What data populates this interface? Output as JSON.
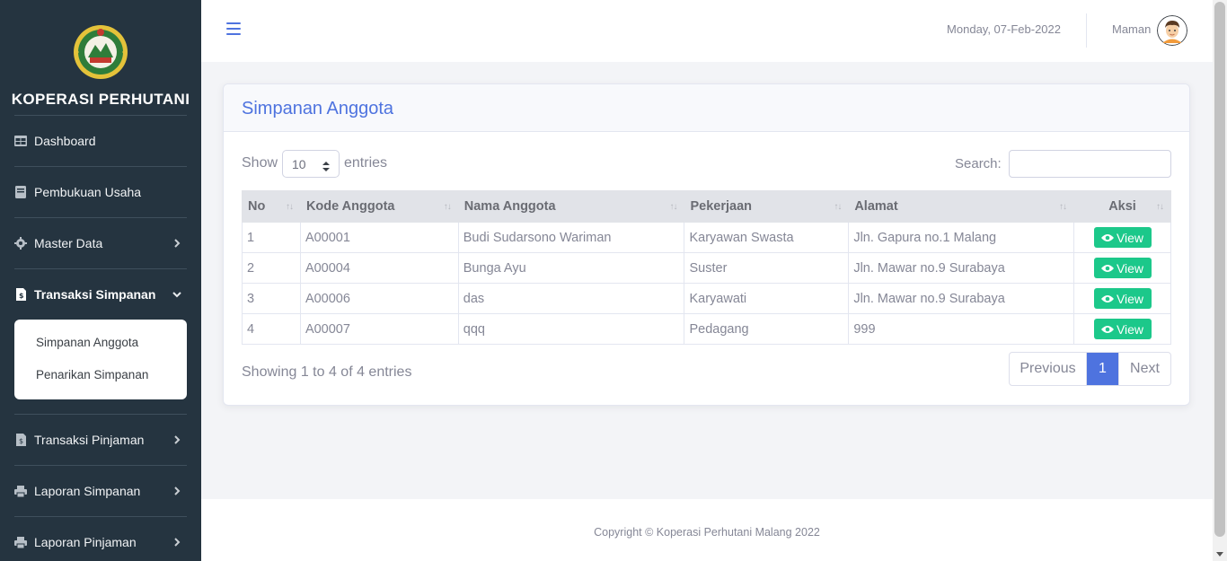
{
  "sidebar": {
    "brand": "KOPERASI PERHUTANI",
    "menu": {
      "dashboard": "Dashboard",
      "pembukuan": "Pembukuan Usaha",
      "master": "Master Data",
      "transaksi_simpanan": "Transaksi Simpanan",
      "transaksi_pinjaman": "Transaksi Pinjaman",
      "laporan_simpanan": "Laporan Simpanan",
      "laporan_pinjaman": "Laporan Pinjaman"
    },
    "submenu": {
      "simpanan_anggota": "Simpanan Anggota",
      "penarikan_simpanan": "Penarikan Simpanan"
    }
  },
  "topbar": {
    "date": "Monday, 07-Feb-2022",
    "user": "Maman"
  },
  "card": {
    "title": "Simpanan Anggota",
    "show_label": "Show",
    "entries_value": "10",
    "entries_label": "entries",
    "search_label": "Search:",
    "search_value": ""
  },
  "table": {
    "headers": {
      "no": "No",
      "kode": "Kode Anggota",
      "nama": "Nama Anggota",
      "pekerjaan": "Pekerjaan",
      "alamat": "Alamat",
      "aksi": "Aksi"
    },
    "rows": [
      {
        "no": "1",
        "kode": "A00001",
        "nama": "Budi Sudarsono Wariman",
        "pekerjaan": "Karyawan Swasta",
        "alamat": "Jln. Gapura no.1 Malang",
        "aksi": "View"
      },
      {
        "no": "2",
        "kode": "A00004",
        "nama": "Bunga Ayu",
        "pekerjaan": "Suster",
        "alamat": "Jln. Mawar no.9 Surabaya",
        "aksi": "View"
      },
      {
        "no": "3",
        "kode": "A00006",
        "nama": "das",
        "pekerjaan": "Karyawati",
        "alamat": "Jln. Mawar no.9 Surabaya",
        "aksi": "View"
      },
      {
        "no": "4",
        "kode": "A00007",
        "nama": "qqq",
        "pekerjaan": "Pedagang",
        "alamat": "999",
        "aksi": "View"
      }
    ]
  },
  "pagination": {
    "info": "Showing 1 to 4 of 4 entries",
    "previous": "Previous",
    "current": "1",
    "next": "Next"
  },
  "footer": {
    "copyright": "Copyright © Koperasi Perhutani Malang 2022"
  },
  "colors": {
    "sidebar_bg": "#253440",
    "primary": "#4e73df",
    "success": "#1cc88a"
  }
}
